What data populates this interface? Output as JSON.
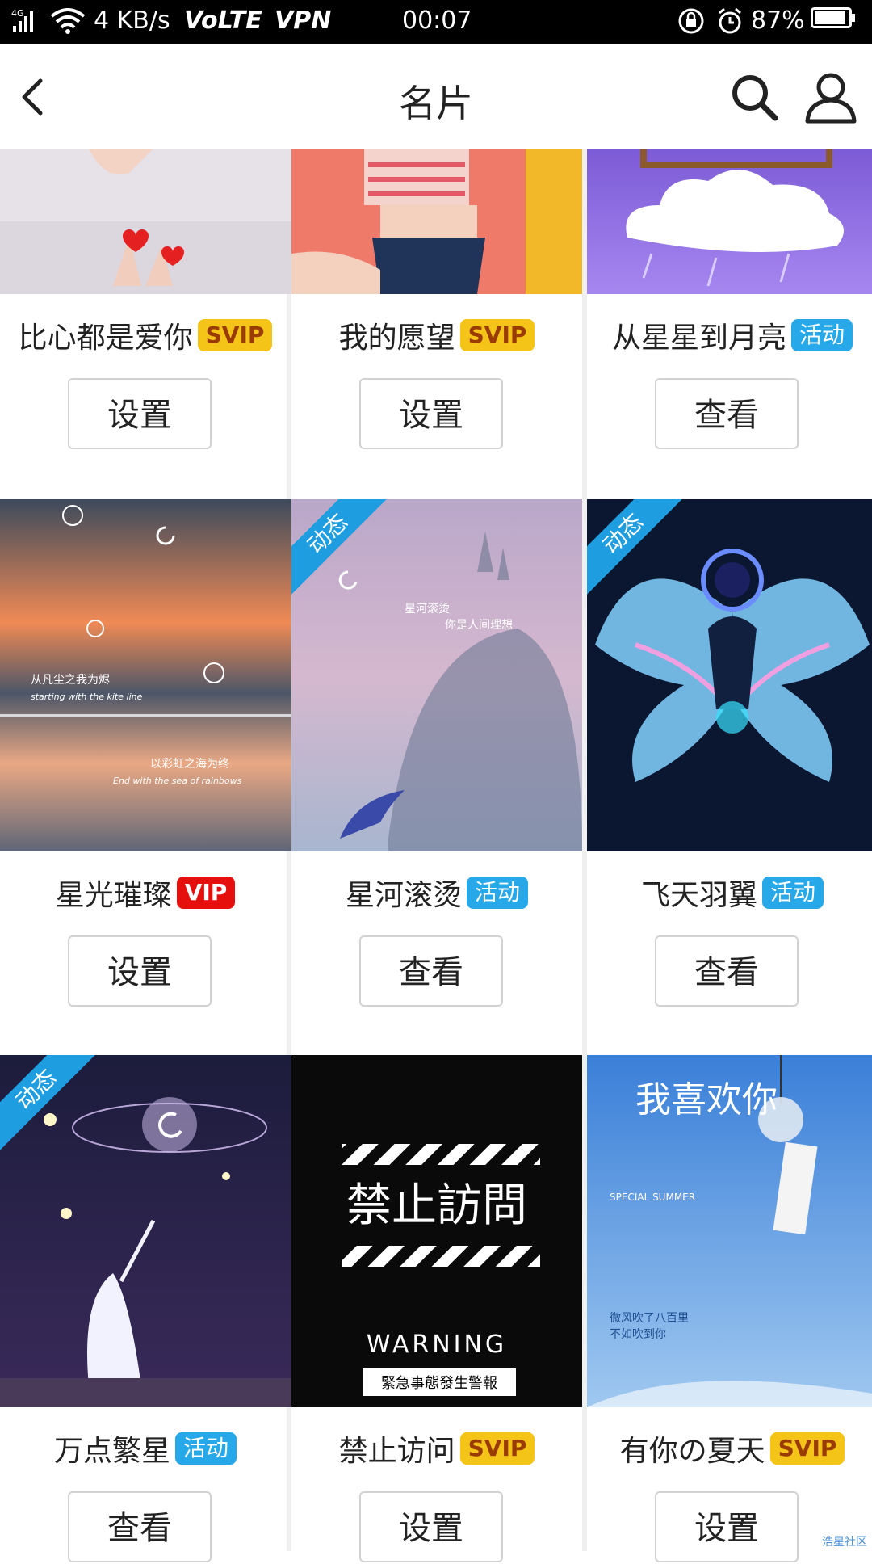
{
  "status_bar": {
    "signal": "4G",
    "speed": "4 KB/s",
    "volte": "VoLTE",
    "vpn": "VPN",
    "time": "00:07",
    "battery": "87%"
  },
  "header": {
    "title": "名片"
  },
  "cards": [
    {
      "title": "比心都是爱你",
      "badge": "SVIP",
      "action": "设置"
    },
    {
      "title": "我的愿望",
      "badge": "SVIP",
      "action": "设置"
    },
    {
      "title": "从星星到月亮",
      "badge": "活动",
      "action": "查看"
    },
    {
      "title": "星光璀璨",
      "badge": "VIP",
      "action": "设置",
      "image_text": [
        "从凡尘之我为烬",
        "starting with the kite line",
        "以彩虹之海为终",
        "End with the sea of rainbows"
      ]
    },
    {
      "title": "星河滚烫",
      "badge": "活动",
      "action": "查看",
      "ribbon": "动态",
      "image_text": [
        "星河滚烫",
        "你是人间理想"
      ]
    },
    {
      "title": "飞天羽翼",
      "badge": "活动",
      "action": "查看",
      "ribbon": "动态"
    },
    {
      "title": "万点繁星",
      "badge": "活动",
      "action": "查看",
      "ribbon": "动态"
    },
    {
      "title": "禁止访问",
      "badge": "SVIP",
      "action": "设置",
      "image_text": [
        "禁止訪問",
        "WARNING",
        "緊急事態發生警報"
      ]
    },
    {
      "title": "有你の夏天",
      "badge": "SVIP",
      "action": "设置",
      "image_text": [
        "我喜欢你",
        "SPECIAL SUMMER",
        "微风吹了八百里",
        "不如吹到你"
      ]
    }
  ],
  "watermark": "浩星社区"
}
